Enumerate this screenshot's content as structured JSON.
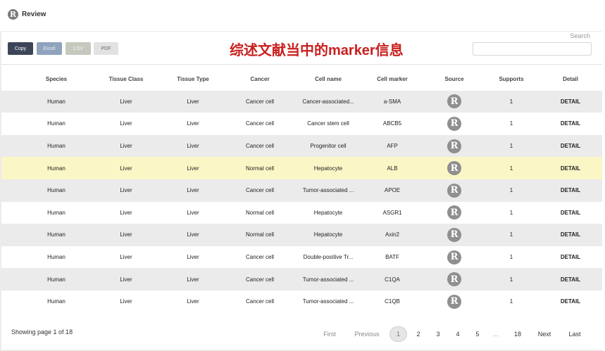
{
  "header": {
    "logo_letter": "R",
    "title": "Review"
  },
  "toolbar": {
    "buttons": [
      "Copy",
      "Excel",
      "CSV",
      "PDF"
    ],
    "overlay_title": "综述文献当中的marker信息",
    "search_label": "Search",
    "search_value": ""
  },
  "table": {
    "columns": [
      "Species",
      "Tissue Class",
      "Tissue Type",
      "Cancer",
      "Cell name",
      "Cell marker",
      "Source",
      "Supports",
      "Detail"
    ],
    "rows": [
      [
        "Human",
        "Liver",
        "Liver",
        "Cancer cell",
        "Cancer-associated...",
        "a-SMA",
        "R",
        "1",
        "DETAIL"
      ],
      [
        "Human",
        "Liver",
        "Liver",
        "Cancer cell",
        "Cancer stem cell",
        "ABCB5",
        "R",
        "1",
        "DETAIL"
      ],
      [
        "Human",
        "Liver",
        "Liver",
        "Cancer cell",
        "Progenitor cell",
        "AFP",
        "R",
        "1",
        "DETAIL"
      ],
      [
        "Human",
        "Liver",
        "Liver",
        "Normal cell",
        "Hepatocyte",
        "ALB",
        "R",
        "1",
        "DETAIL"
      ],
      [
        "Human",
        "Liver",
        "Liver",
        "Cancer cell",
        "Tumor-associated ...",
        "APOE",
        "R",
        "1",
        "DETAIL"
      ],
      [
        "Human",
        "Liver",
        "Liver",
        "Normal cell",
        "Hepatocyte",
        "ASGR1",
        "R",
        "1",
        "DETAIL"
      ],
      [
        "Human",
        "Liver",
        "Liver",
        "Normal cell",
        "Hepatocyte",
        "Axin2",
        "R",
        "1",
        "DETAIL"
      ],
      [
        "Human",
        "Liver",
        "Liver",
        "Cancer cell",
        "Double-positive Tr...",
        "BATF",
        "R",
        "1",
        "DETAIL"
      ],
      [
        "Human",
        "Liver",
        "Liver",
        "Cancer cell",
        "Tumor-associated ...",
        "C1QA",
        "R",
        "1",
        "DETAIL"
      ],
      [
        "Human",
        "Liver",
        "Liver",
        "Cancer cell",
        "Tumor-associated ...",
        "C1QB",
        "R",
        "1",
        "DETAIL"
      ]
    ],
    "highlighted_row": 3
  },
  "pagination": {
    "showing": "Showing page 1 of 18",
    "first": "First",
    "previous": "Previous",
    "pages": [
      "1",
      "2",
      "3",
      "4",
      "5",
      "…",
      "18"
    ],
    "current": "1",
    "next": "Next",
    "last": "Last"
  },
  "colors": {
    "overlay_title": "#c8201e",
    "copy_button": "#3c4658",
    "highlight_row": "#fbf6c6",
    "odd_row": "#ebebeb"
  }
}
